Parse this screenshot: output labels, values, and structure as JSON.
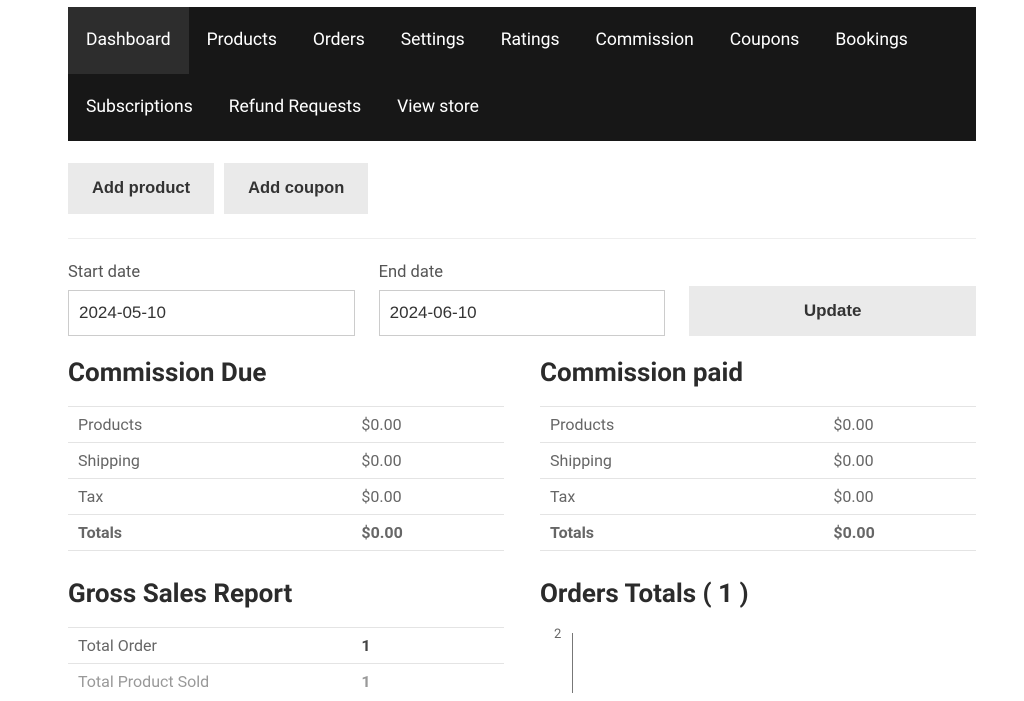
{
  "nav": {
    "items": [
      {
        "label": "Dashboard",
        "active": true
      },
      {
        "label": "Products"
      },
      {
        "label": "Orders"
      },
      {
        "label": "Settings"
      },
      {
        "label": "Ratings"
      },
      {
        "label": "Commission"
      },
      {
        "label": "Coupons"
      },
      {
        "label": "Bookings"
      },
      {
        "label": "Subscriptions"
      },
      {
        "label": "Refund Requests"
      },
      {
        "label": "View store"
      }
    ]
  },
  "buttons": {
    "add_product": "Add product",
    "add_coupon": "Add coupon",
    "update": "Update"
  },
  "date_filter": {
    "start_label": "Start date",
    "start_value": "2024-05-10",
    "end_label": "End date",
    "end_value": "2024-06-10"
  },
  "commission_due": {
    "title": "Commission Due",
    "rows": [
      {
        "label": "Products",
        "value": "$0.00"
      },
      {
        "label": "Shipping",
        "value": "$0.00"
      },
      {
        "label": "Tax",
        "value": "$0.00"
      }
    ],
    "totals_label": "Totals",
    "totals_value": "$0.00"
  },
  "commission_paid": {
    "title": "Commission paid",
    "rows": [
      {
        "label": "Products",
        "value": "$0.00"
      },
      {
        "label": "Shipping",
        "value": "$0.00"
      },
      {
        "label": "Tax",
        "value": "$0.00"
      }
    ],
    "totals_label": "Totals",
    "totals_value": "$0.00"
  },
  "gross_sales": {
    "title": "Gross Sales Report",
    "rows": [
      {
        "label": "Total Order",
        "value": "1"
      },
      {
        "label": "Total Product Sold",
        "value": "1"
      }
    ]
  },
  "orders_totals": {
    "title": "Orders Totals ( 1 )"
  },
  "chart_data": {
    "type": "bar",
    "title": "Orders Totals ( 1 )",
    "ylim": [
      0,
      2
    ],
    "yticks": [
      2
    ],
    "categories": [],
    "values": []
  }
}
